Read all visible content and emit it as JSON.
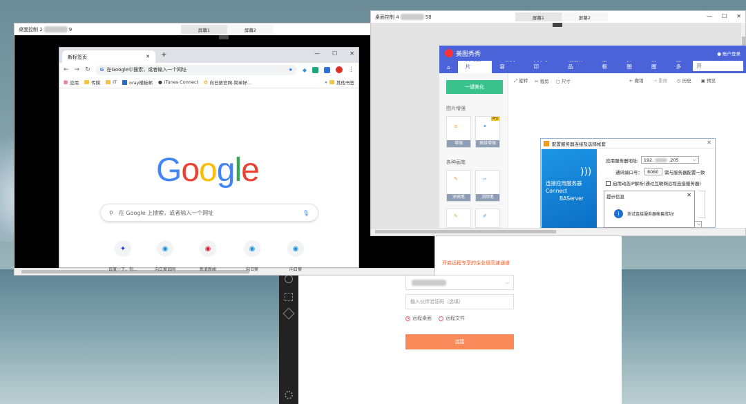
{
  "left_window": {
    "title": "桌面控制 2",
    "title_suffix": "9",
    "tabs": [
      "屏幕1",
      "屏幕2"
    ]
  },
  "chrome": {
    "tab_title": "新标签页",
    "new_tab": "+",
    "omnibox": "在Google中搜索，或者输入一个网址",
    "bookmarks": [
      "应用",
      "传媒",
      "IT",
      "oray模板邮",
      "iTunes Connect",
      "向日葵官网-简单好...",
      "其他书签"
    ],
    "search_placeholder": "在 Google 上搜索，或者输入一个网址",
    "shortcuts": [
      "百度一下，你...",
      "向日葵官网",
      "新浪新闻",
      "向日葵",
      "向日葵"
    ]
  },
  "right_window": {
    "title": "桌面控制 4",
    "title_suffix": "58",
    "tabs": [
      "屏幕1",
      "屏幕2"
    ]
  },
  "meitu": {
    "app_name": "美图秀秀",
    "login": "账户登录",
    "nav": [
      "美化图片",
      "人像美容",
      "文字水印",
      "贴纸饰品",
      "边框",
      "拼图",
      "抠图",
      "更多"
    ],
    "open_btn": "打开",
    "tools": [
      "旋转",
      "裁剪",
      "尺寸"
    ],
    "history_tools": [
      "撤销",
      "重做",
      "历史",
      "预览"
    ],
    "one_click": "一键美化",
    "enhance_heading": "图片增强",
    "enhance_items": [
      "增强",
      "高级增强"
    ],
    "pro_badge": "Pro",
    "brush_heading": "各种画笔",
    "brush_items": [
      "涂鸦笔",
      "消除笔"
    ]
  },
  "ba_dialog": {
    "title": "配置服务器连接及选择帐套",
    "left_line1": "连接应用服务器",
    "left_line2": "Connect",
    "left_line3": "BAServer",
    "server_label": "应用服务器地址:",
    "server_prefix": "192.",
    "server_suffix": ".205",
    "port_label": "通讯端口号：",
    "port_value": "8080",
    "port_hint": "需与服务器配置一致",
    "dynamic_label": "启用动态IP解析(通过互联网远程连接服务器)",
    "tip_title": "提示信息",
    "tip_text": "测试连接服务器帐套成功!"
  },
  "client": {
    "promo": "开启远程专享的企业级高速通道",
    "code_placeholder": "输入伙伴验证码（选填）",
    "mode_desktop": "远程桌面",
    "mode_file": "远程文件",
    "connect": "连接"
  },
  "colors": {
    "meitu_blue": "#4a63d9",
    "google_blue": "#4285F4",
    "google_red": "#EA4335",
    "google_yellow": "#FBBC05",
    "google_green": "#34A853",
    "connect_orange": "#fa8a5a"
  }
}
